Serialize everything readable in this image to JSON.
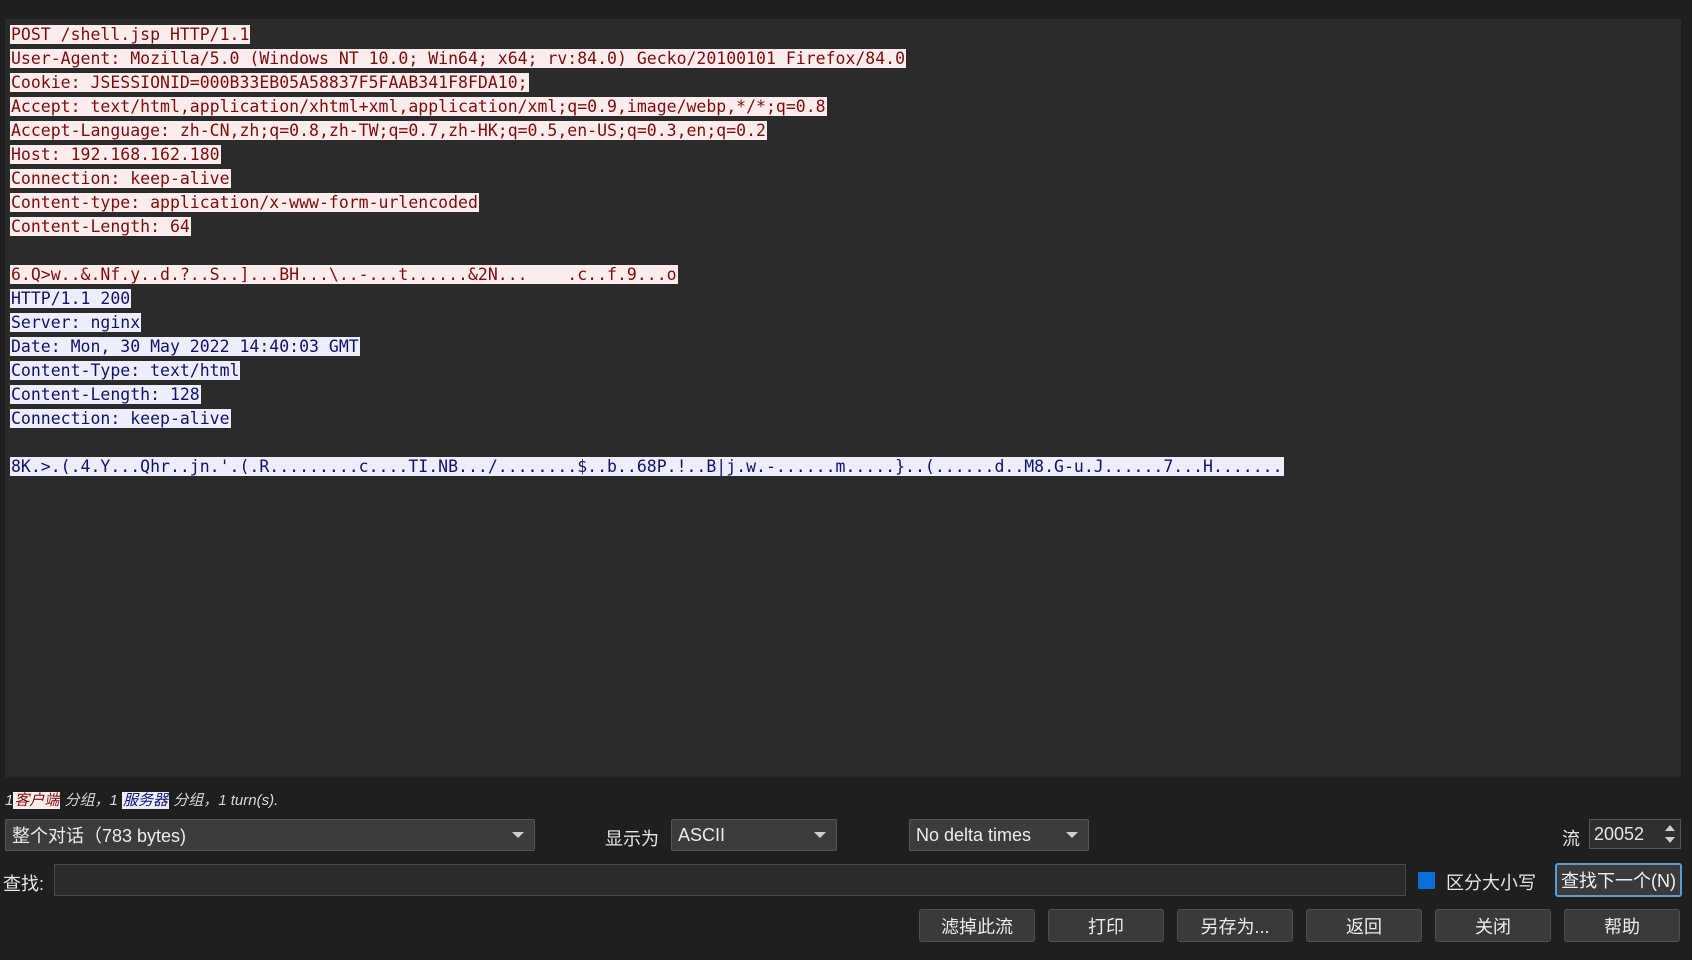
{
  "stream": {
    "request_lines": [
      "POST /shell.jsp HTTP/1.1",
      "User-Agent: Mozilla/5.0 (Windows NT 10.0; Win64; x64; rv:84.0) Gecko/20100101 Firefox/84.0",
      "Cookie: JSESSIONID=000B33EB05A58837F5FAAB341F8FDA10;",
      "Accept: text/html,application/xhtml+xml,application/xml;q=0.9,image/webp,*/*;q=0.8",
      "Accept-Language: zh-CN,zh;q=0.8,zh-TW;q=0.7,zh-HK;q=0.5,en-US;q=0.3,en;q=0.2",
      "Host: 192.168.162.180",
      "Connection: keep-alive",
      "Content-type: application/x-www-form-urlencoded",
      "Content-Length: 64"
    ],
    "request_body": "6.Q>w..&.Nf.y..d.?..S..]...BH...\\..-...t......&2N...    .c..f.9...o",
    "response_lines": [
      "HTTP/1.1 200",
      "Server: nginx",
      "Date: Mon, 30 May 2022 14:40:03 GMT",
      "Content-Type: text/html",
      "Content-Length: 128",
      "Connection: keep-alive"
    ],
    "response_body": "8K.>.(.4.Y...Qhr..jn.'.(.R.........c....TI.NB.../........$..b..68P.!..B|j.w.-......m.....}..(......d..M8.G-u.J......7...H.......",
    "client_color": "#7f0a0a",
    "server_color": "#11116e"
  },
  "summary": {
    "count_client": "1",
    "client_tag": "客户端",
    "mid_text": " 分组，1 ",
    "server_tag": "服务器",
    "tail_text": " 分组，1 turn(s)."
  },
  "controls": {
    "conversation_select": "整个对话（783 bytes)",
    "show_as_label": "显示为",
    "show_as_value": "ASCII",
    "delta_select": "No delta times",
    "stream_label": "流",
    "stream_value": "20052",
    "find_label": "查找:",
    "find_value": "",
    "case_sensitive_label": "区分大小写",
    "case_sensitive_checked": true,
    "find_next_label": "查找下一个(N)"
  },
  "buttons": {
    "filter_out": "滤掉此流",
    "print": "打印",
    "save_as": "另存为...",
    "back": "返回",
    "close": "关闭",
    "help": "帮助"
  }
}
